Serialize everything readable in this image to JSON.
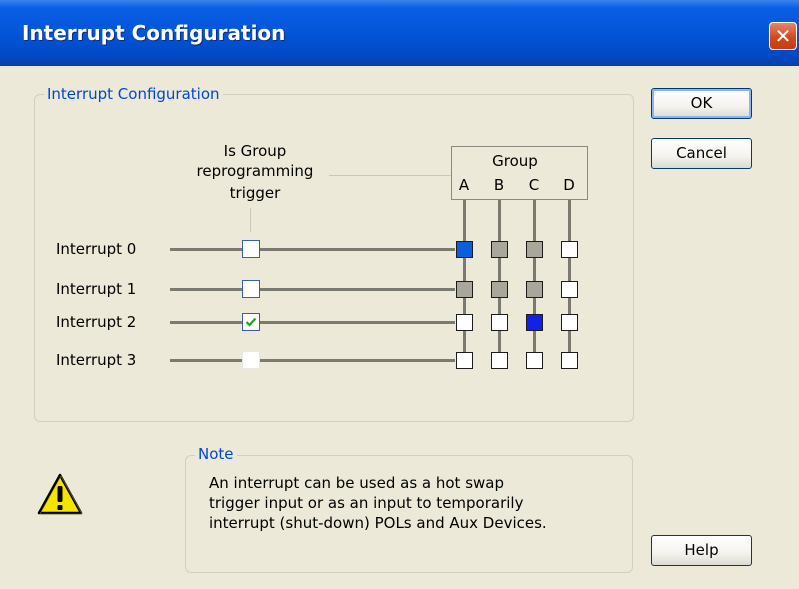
{
  "window": {
    "title": "Interrupt Configuration",
    "close_label": "✕"
  },
  "config_group": {
    "legend": "Interrupt Configuration"
  },
  "trigger_header": {
    "line1": "Is Group",
    "line2": "reprogramming",
    "line3": "trigger"
  },
  "group_header": {
    "title": "Group",
    "columns": [
      "A",
      "B",
      "C",
      "D"
    ]
  },
  "interrupts": [
    {
      "label": "Interrupt 0",
      "trigger_checked": false,
      "trigger_enabled": true,
      "groups": [
        "blue-selected",
        "gray",
        "gray",
        "white"
      ]
    },
    {
      "label": "Interrupt 1",
      "trigger_checked": false,
      "trigger_enabled": true,
      "groups": [
        "gray",
        "gray",
        "gray",
        "white"
      ]
    },
    {
      "label": "Interrupt 2",
      "trigger_checked": true,
      "trigger_enabled": true,
      "groups": [
        "white",
        "white",
        "blue-selected-dark",
        "white"
      ]
    },
    {
      "label": "Interrupt 3",
      "trigger_checked": false,
      "trigger_enabled": false,
      "groups": [
        "white",
        "white",
        "white",
        "white"
      ]
    }
  ],
  "buttons": {
    "ok": "OK",
    "cancel": "Cancel",
    "help": "Help"
  },
  "note": {
    "legend": "Note",
    "lines": [
      "An interrupt can be used as a hot swap",
      "trigger input or as an input to temporarily",
      "interrupt (shut-down) POLs and Aux Devices."
    ],
    "icon": "warning-icon"
  },
  "colors": {
    "accent": "#0355d8",
    "legend_text": "#0046d5",
    "selected_blue": "#0b5fdc",
    "selected_dark_blue": "#1022e8",
    "gray_cell": "#a9a79b"
  }
}
